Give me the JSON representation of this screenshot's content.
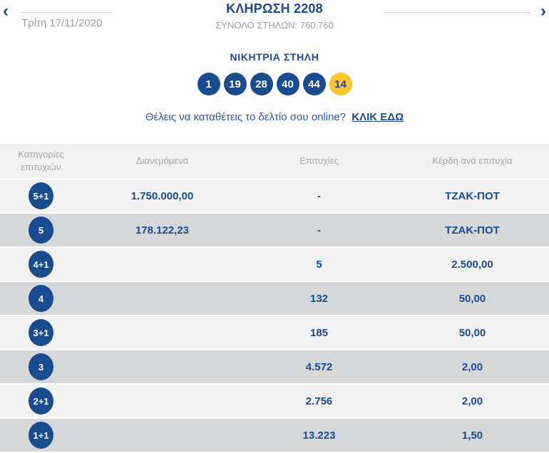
{
  "header": {
    "title": "ΚΛΗΡΩΣΗ 2208",
    "subtitle": "ΣΥΝΟΛΟ ΣΤΗΛΩΝ: 760.760",
    "date": "Τρίτη 17/11/2020",
    "prev_arrow": "‹",
    "next_arrow": "›"
  },
  "winning": {
    "title": "ΝΙΚΗΤΡΙΑ ΣΤΗΛΗ",
    "numbers": [
      "1",
      "19",
      "28",
      "40",
      "44"
    ],
    "joker": "14"
  },
  "online": {
    "text": "Θέλεις να καταθέτεις το δελτίο σου online?",
    "link_label": "ΚΛΙΚ ΕΔΩ"
  },
  "table": {
    "columns": {
      "category": "Κατηγορίες επιτυχιών",
      "distributed": "Διανεμόμενα",
      "winners": "Επιτυχίες",
      "prize": "Κέρδη ανά επιτυχία"
    },
    "rows": [
      {
        "category": "5+1",
        "distributed": "1.750.000,00",
        "winners": "-",
        "prize": "ΤΖΑΚ-ΠΟΤ"
      },
      {
        "category": "5",
        "distributed": "178.122,23",
        "winners": "-",
        "prize": "ΤΖΑΚ-ΠΟΤ"
      },
      {
        "category": "4+1",
        "distributed": "",
        "winners": "5",
        "prize": "2.500,00"
      },
      {
        "category": "4",
        "distributed": "",
        "winners": "132",
        "prize": "50,00"
      },
      {
        "category": "3+1",
        "distributed": "",
        "winners": "185",
        "prize": "50,00"
      },
      {
        "category": "3",
        "distributed": "",
        "winners": "4.572",
        "prize": "2,00"
      },
      {
        "category": "2+1",
        "distributed": "",
        "winners": "2.756",
        "prize": "2,00"
      },
      {
        "category": "1+1",
        "distributed": "",
        "winners": "13.223",
        "prize": "1,50"
      }
    ]
  },
  "colors": {
    "brand_blue": "#1a4b8e",
    "joker_yellow": "#fdc42d",
    "light_row": "#f1f1f2",
    "dark_row": "#d6d7d8",
    "muted_text": "#9ba0a5"
  }
}
